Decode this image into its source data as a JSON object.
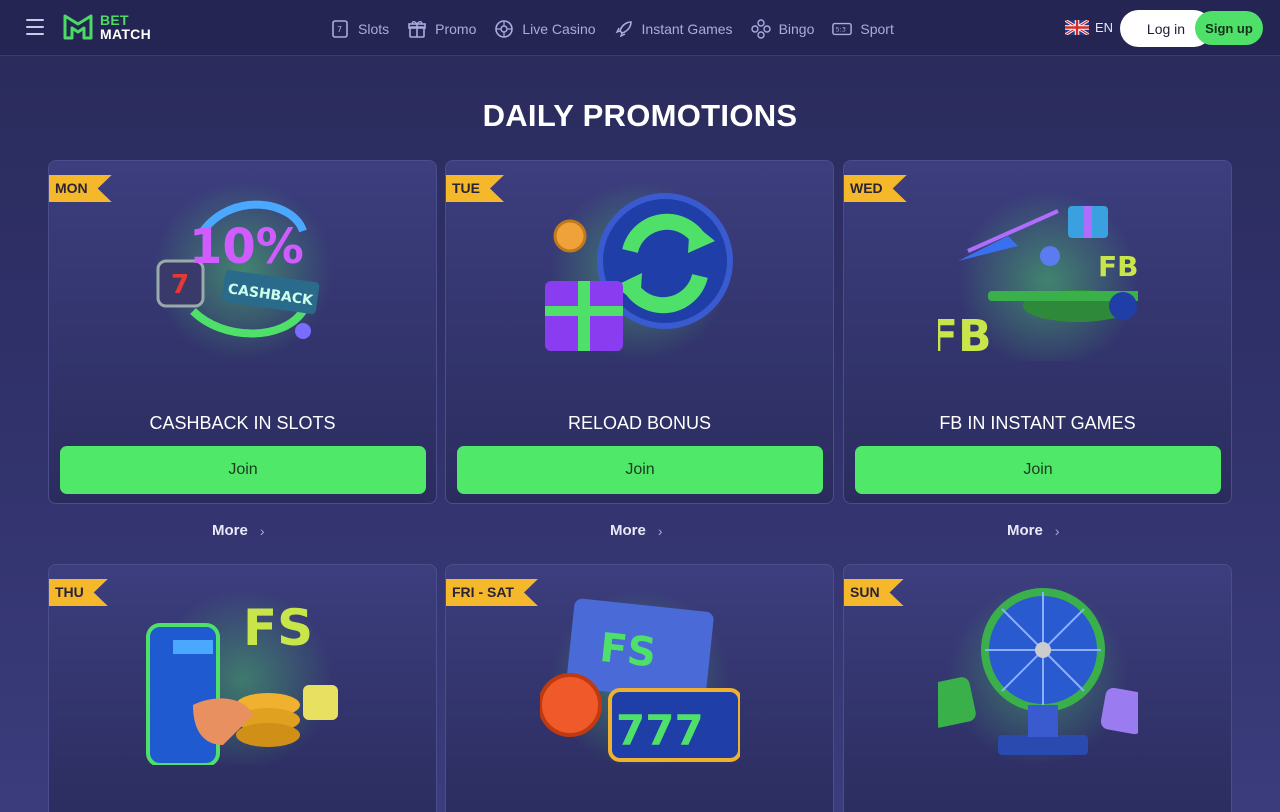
{
  "brand": {
    "line1": "BET",
    "line2": "MATCH"
  },
  "nav": [
    {
      "label": "Slots",
      "icon": "slot-icon"
    },
    {
      "label": "Promo",
      "icon": "gift-icon"
    },
    {
      "label": "Live Casino",
      "icon": "roulette-icon"
    },
    {
      "label": "Instant Games",
      "icon": "rocket-icon"
    },
    {
      "label": "Bingo",
      "icon": "bingo-icon"
    },
    {
      "label": "Sport",
      "icon": "scoreboard-icon"
    }
  ],
  "lang": {
    "code": "EN",
    "flag": "uk-flag-icon"
  },
  "auth": {
    "login": "Log in",
    "signup": "Sign up"
  },
  "page_title": "DAILY PROMOTIONS",
  "promos": [
    {
      "day": "MON",
      "title": "CASHBACK IN SLOTS",
      "join": "Join",
      "more": "More"
    },
    {
      "day": "TUE",
      "title": "RELOAD BONUS",
      "join": "Join",
      "more": "More"
    },
    {
      "day": "WED",
      "title": "FB IN INSTANT GAMES",
      "join": "Join",
      "more": "More"
    },
    {
      "day": "THU"
    },
    {
      "day": "FRI - SAT"
    },
    {
      "day": "SUN"
    }
  ],
  "art_text": {
    "cashback_pct": "10%",
    "cashback": "CASHBACK",
    "fb": "FB",
    "fs": "FS",
    "sevens": "777"
  },
  "colors": {
    "accent_green": "#4fe06a",
    "ribbon_yellow": "#f5b82a",
    "background": "#2f3068"
  }
}
